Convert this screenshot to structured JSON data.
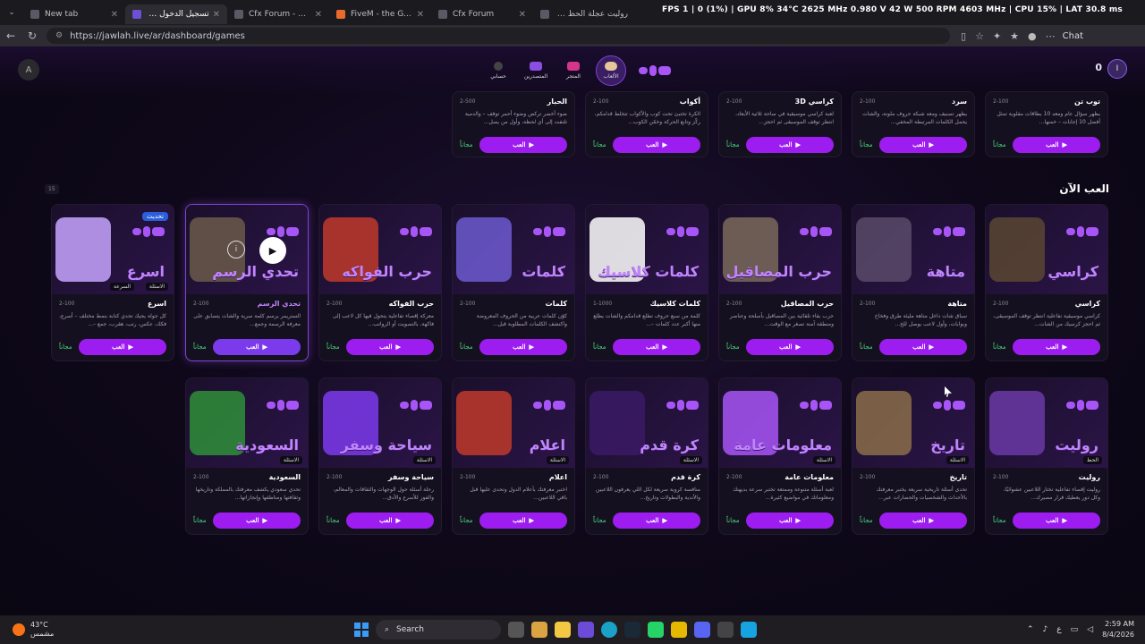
{
  "browser": {
    "tabs": [
      {
        "label": "New tab",
        "active": false
      },
      {
        "label": "تسجيل الدخول إلى جولة",
        "active": true
      },
      {
        "label": "Cfx Forum - The hom",
        "active": false
      },
      {
        "label": "FiveM - the GTA V m",
        "active": false
      },
      {
        "label": "Cfx Forum",
        "active": false
      },
      {
        "label": "روليت عجلة الحظ - بحث",
        "active": false
      }
    ],
    "url": "https://jawlah.live/ar/dashboard/games",
    "overlay_stats": "FPS 1 | 0 (1%) | GPU 8% 34°C 2625 MHz 0.980 V 42 W 500 RPM 4603 MHz | CPU 15% | LAT 30.8 ms",
    "chat_label": "Chat"
  },
  "header": {
    "nav": [
      {
        "label": "حسابي",
        "icon": "account-icon",
        "active": false
      },
      {
        "label": "المتصدرين",
        "icon": "leaderboard-icon",
        "active": false
      },
      {
        "label": "المتجر",
        "icon": "store-icon",
        "active": false
      },
      {
        "label": "الألعاب",
        "icon": "games-icon",
        "active": true
      }
    ],
    "coins": "0",
    "avatar_letter": "I",
    "left_logo": "A"
  },
  "top_row": [
    {
      "name": "توب تن",
      "players": "2-100",
      "desc": "يظهر سؤال عام ومعه 10 بطاقات مقلوبة تمثل أفضل 10 إجابات – خمنها...",
      "free": "مجاناً",
      "play": "العب"
    },
    {
      "name": "سرد",
      "players": "2-100",
      "desc": "يظهر تصنيف ومعه شبكة حروف ملونة، والشات يحمل الكلمات المرتبطة المخفي...",
      "free": "مجاناً",
      "play": "العب"
    },
    {
      "name": "كراسي 3D",
      "players": "2-100",
      "desc": "لعبة كراسي موسيقية في ساحة ثلاثية الأبعاد، انتظر توقف الموسيقى ثم احجز...",
      "free": "مجاناً",
      "play": "العب"
    },
    {
      "name": "أكواب",
      "players": "2-100",
      "desc": "الكرة تختبئ تحت كوب والأكواب تتخلط قدامكم، ركّز وتابع الحركة وخمّن الكوب...",
      "free": "مجاناً",
      "play": "العب"
    },
    {
      "name": "الحبار",
      "players": "2-500",
      "desc": "ضوء أخضر تركض وضوء أحمر توقف – والدمية تلتفت إلى أي لحظة، وأول من يصل...",
      "free": "مجاناً",
      "play": "العب"
    }
  ],
  "section_title": "العب الآن",
  "side_badge": "15",
  "row1": [
    {
      "name": "كراسي",
      "title": "كراسي",
      "players": "2-100",
      "desc": "كراسي موسيقية تفاعلية انتظر توقف الموسيقى، ثم احجز كرسيك من الشات...",
      "free": "مجاناً",
      "play": "العب",
      "tag": "",
      "tag2": ""
    },
    {
      "name": "متاهة",
      "title": "متاهة",
      "players": "2-100",
      "desc": "سباق شات داخل متاهة مليئة طرق وفخاخ وبوابات، وأول لاعب يوصل للخ...",
      "free": "مجاناً",
      "play": "العب",
      "tag": "",
      "tag2": ""
    },
    {
      "name": "حرب المصاقيل",
      "title": "حرب المصاقيل",
      "players": "2-100",
      "desc": "حرب بقاء تلقائية بين المصاقيل بأسلحة وعناصر ومنطقة آمنة تصغر مع الوقت...",
      "free": "مجاناً",
      "play": "العب",
      "tag": "",
      "tag2": ""
    },
    {
      "name": "كلمات كلاسيك",
      "title": "كلمات كلاسيك",
      "players": "1-1000",
      "desc": "كلمة من سبع حروف تطلع قدامكم والشات يطلع منها أكبر عدد كلمات –...",
      "free": "مجاناً",
      "play": "العب",
      "tag": "",
      "tag2": ""
    },
    {
      "name": "كلمات",
      "title": "كلمات",
      "players": "2-100",
      "desc": "كوّن كلمات عربية من الحروف المعروضة واكتشف الكلمات المطلوبة قبل...",
      "free": "مجاناً",
      "play": "العب",
      "tag": "",
      "tag2": ""
    },
    {
      "name": "حرب الفواكه",
      "title": "حرب الفواكه",
      "players": "2-100",
      "desc": "معركة إقصاء تفاعلية يتحول فيها كل لاعب إلى فاكهة، بالتصويت أو الرواتب...",
      "free": "مجاناً",
      "play": "العب",
      "tag": "",
      "tag2": ""
    },
    {
      "name": "تحدي الرسم",
      "title": "تحدي الرسم",
      "players": "2-100",
      "desc": "الستريمر يرسم كلمة سرية والشات يتسابق على معرفة الرسمة وجمع...",
      "free": "مجاناً",
      "play": "العب",
      "tag": "",
      "tag2": "",
      "hover": true
    },
    {
      "name": "اسرع",
      "title": "اسرع",
      "players": "2-100",
      "desc": "كل جولة يجيك تحدي كتابة بنمط مختلف – أسرع، فكك، عكس، رتب، هقرب، جمع –...",
      "free": "مجاناً",
      "play": "العب",
      "tag": "الاسئلة",
      "tag2": "السرعة",
      "badge": "تحديث"
    }
  ],
  "row2": [
    {
      "name": "روليت",
      "title": "روليت",
      "players": "2-100",
      "desc": "روليت إقصاء تفاعلية تختار اللاعبين عشوائيًا، وكل دور يعطيك قرار مصيرك...",
      "free": "مجاناً",
      "play": "العب",
      "tag": "الحظ"
    },
    {
      "name": "تاريخ",
      "title": "تاريخ",
      "players": "2-100",
      "desc": "تحدى أسئلة تاريخية سريعة يختبر معرفتك بالأحداث والشخصيات والحضارات عبر...",
      "free": "مجاناً",
      "play": "العب",
      "tag": "الاسئلة"
    },
    {
      "name": "معلومات عامة",
      "title": "معلومات عامة",
      "players": "2-100",
      "desc": "لعبة أسئلة متنوعة وممتعة تختبر سرعة بديهتك ومعلوماتك في مواضيع كثيرة...",
      "free": "مجاناً",
      "play": "العب",
      "tag": "الاسئلة"
    },
    {
      "name": "كرة قدم",
      "title": "كرة قدم",
      "players": "2-100",
      "desc": "منافسة كروية سريعة لكل اللي يعرفون اللاعبين والأندية والبطولات وتاريخ...",
      "free": "مجاناً",
      "play": "العب",
      "tag": "الاسئلة"
    },
    {
      "name": "اعلام",
      "title": "اعلام",
      "players": "2-100",
      "desc": "اختبر معرفتك بأعلام الدول وتحدى عليها قبل باقي اللاعبين...",
      "free": "مجاناً",
      "play": "العب",
      "tag": "الاسئلة"
    },
    {
      "name": "سياحة وسفر",
      "title": "سياحة وسفر",
      "players": "2-100",
      "desc": "رحلة أسئلة حول الوجهات والثقافات والمعالم، والفوز للأسرع والأدق...",
      "free": "مجاناً",
      "play": "العب",
      "tag": "الاسئلة"
    },
    {
      "name": "السعودية",
      "title": "السعودية",
      "players": "2-100",
      "desc": "تحدي سعودي يكشف معرفتك بالمملكة وتاريخها وثقافتها ومناطقها وإنجازاتها...",
      "free": "مجاناً",
      "play": "العب",
      "tag": "الاسئلة"
    }
  ],
  "taskbar": {
    "weather_temp": "43°C",
    "weather_desc": "مشمس",
    "search_label": "Search",
    "lang": "ع",
    "time": "2:59 AM",
    "date": "8/4/2026"
  },
  "colors": {
    "accent": "#9d1df0",
    "brand": "#a855f7",
    "free": "#4ade80",
    "bg": "#0c0716"
  }
}
